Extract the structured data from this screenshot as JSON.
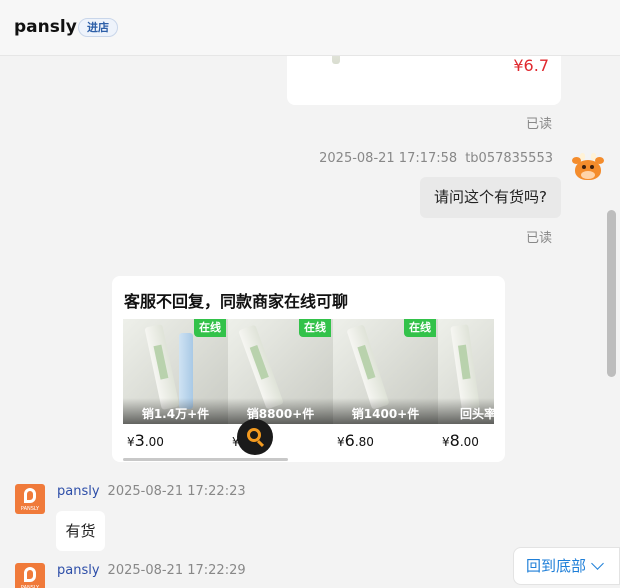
{
  "header": {
    "shop_name": "pansly",
    "enter_button": "进店"
  },
  "messages": {
    "prev_product_price": "¥6.7",
    "read_label_1": "已读",
    "outgoing": {
      "timestamp": "2025-08-21 17:17:58",
      "user": "tb057835553",
      "text": "请问这个有货吗?",
      "read_label": "已读"
    },
    "recommend": {
      "title": "客服不回复，同款商家在线可聊",
      "items": [
        {
          "badge": "在线",
          "sales": "销1.4万+件",
          "currency": "¥",
          "price_int": "3",
          "price_dec": ".00"
        },
        {
          "badge": "在线",
          "sales": "销8800+件",
          "currency": "¥",
          "price_int": "",
          "price_dec": ""
        },
        {
          "badge": "在线",
          "sales": "销1400+件",
          "currency": "¥",
          "price_int": "6",
          "price_dec": ".80"
        },
        {
          "badge": "",
          "sales": "回头率",
          "currency": "¥",
          "price_int": "8",
          "price_dec": ".00"
        }
      ]
    },
    "reply_1": {
      "name": "pansly",
      "timestamp": "2025-08-21 17:22:23",
      "text": "有货"
    },
    "reply_2": {
      "name": "pansly",
      "timestamp": "2025-08-21 17:22:29"
    },
    "shop_avatar_label": "PANSLY"
  },
  "back_to_bottom": "回到底部",
  "colors": {
    "price_red": "#e0282e",
    "online_green": "#33c24a",
    "link_blue": "#1f7fd8",
    "name_blue": "#2d4ea8"
  }
}
